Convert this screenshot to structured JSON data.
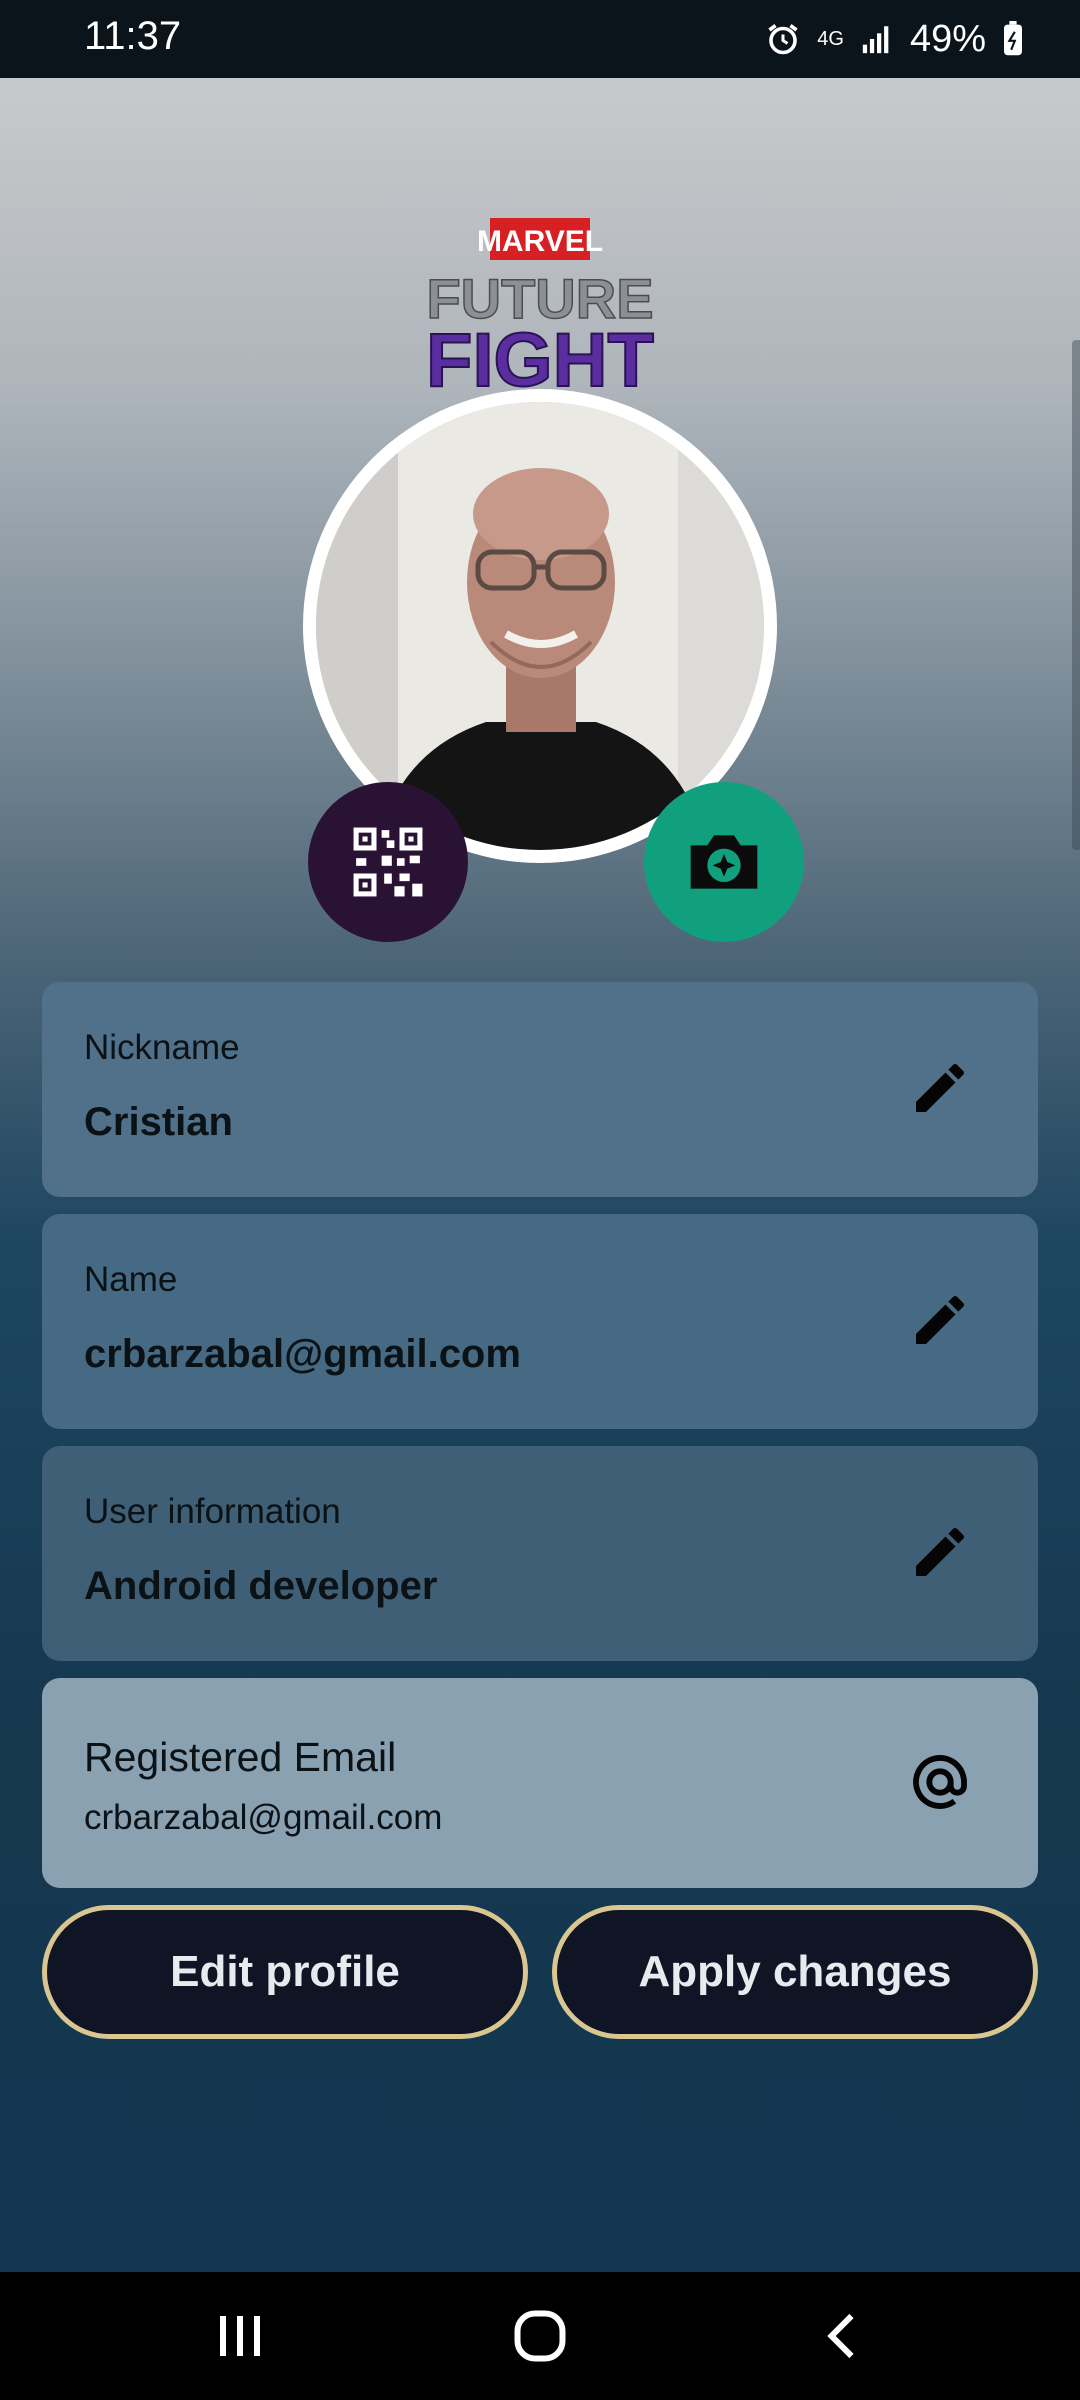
{
  "status_bar": {
    "time": "11:37",
    "network": "4G",
    "battery": "49%",
    "icons": [
      "alarm-icon",
      "data-transfer-icon",
      "signal-icon",
      "battery-icon"
    ]
  },
  "logo": {
    "brand": "MARVEL",
    "line1": "FUTURE",
    "line2": "FIGHT"
  },
  "profile": {
    "photo": "profile-photo",
    "qr_button_icon": "qr-code-icon",
    "camera_button_icon": "camera-icon"
  },
  "fields": {
    "nickname": {
      "label": "Nickname",
      "value": "Cristian"
    },
    "name": {
      "label": "Name",
      "value": "crbarzabal@gmail.com"
    },
    "user_info": {
      "label": "User information",
      "value": "Android developer"
    },
    "registered_email": {
      "label": "Registered Email",
      "value": "crbarzabal@gmail.com"
    }
  },
  "buttons": {
    "edit_profile": "Edit profile",
    "apply_changes": "Apply changes"
  },
  "colors": {
    "accent_green": "#11a07d",
    "qr_purple": "#2a1235",
    "button_border": "#d9c690",
    "button_bg": "#0f1524"
  }
}
